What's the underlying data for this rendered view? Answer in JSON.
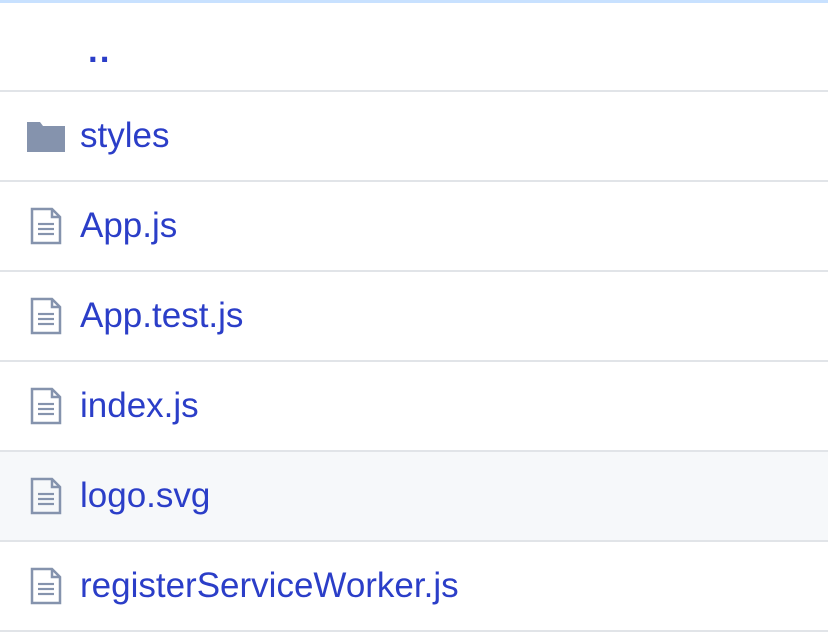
{
  "file_list": {
    "parent": {
      "label": ".."
    },
    "items": [
      {
        "type": "folder",
        "icon": "folder-icon",
        "label": "styles"
      },
      {
        "type": "file",
        "icon": "file-text-icon",
        "label": "App.js"
      },
      {
        "type": "file",
        "icon": "file-text-icon",
        "label": "App.test.js"
      },
      {
        "type": "file",
        "icon": "file-text-icon",
        "label": "index.js"
      },
      {
        "type": "file",
        "icon": "file-text-icon",
        "label": "logo.svg"
      },
      {
        "type": "file",
        "icon": "file-text-icon",
        "label": "registerServiceWorker.js"
      }
    ]
  },
  "colors": {
    "link": "#2b3ec8",
    "icon": "#8593ad",
    "divider": "#e1e4e8",
    "top_border": "#c8e1ff",
    "row_hover": "#f6f8fa"
  }
}
